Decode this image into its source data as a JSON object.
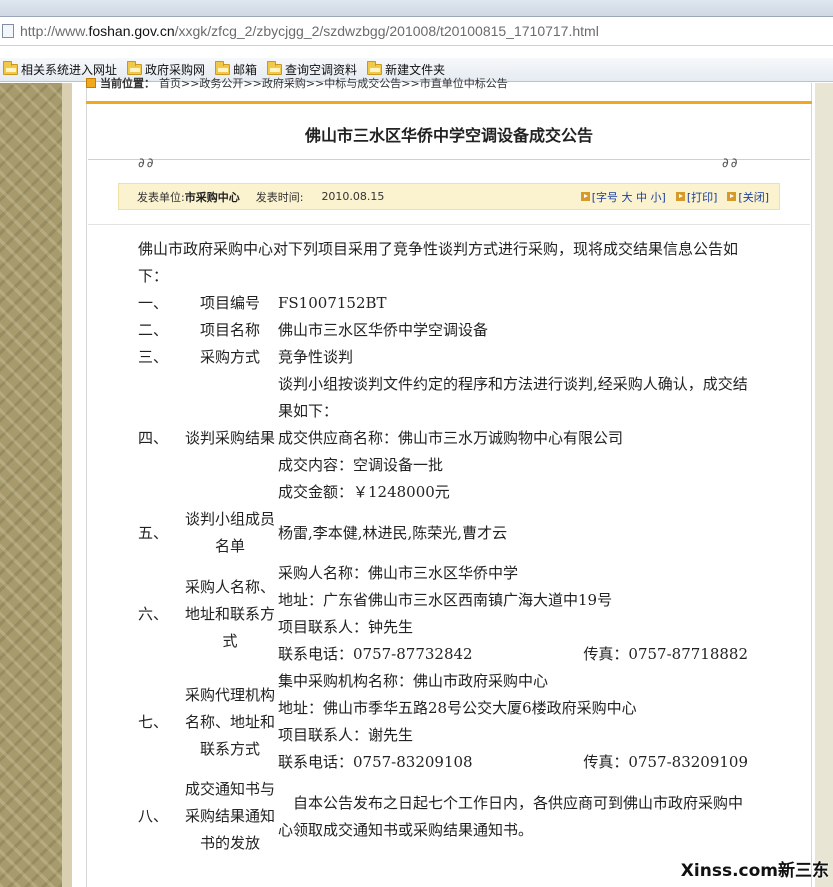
{
  "browser": {
    "url_gray_prefix": "http://www.",
    "url_domain": "foshan.gov.cn",
    "url_path": "/xxgk/zfcg_2/zbycjgg_2/szdwzbgg/201008/t20100815_1710717.html",
    "favorites": [
      "相关系统进入网址",
      "政府采购网",
      "邮箱",
      "查询空调资料",
      "新建文件夹"
    ]
  },
  "breadcrumb": {
    "label": "当前位置：",
    "path": "首页>>政务公开>>政府采购>>中标与成交公告>>市直单位中标公告"
  },
  "article": {
    "title": "佛山市三水区华侨中学空调设备成交公告",
    "rings_left": "∂∂",
    "rings_right": "∂∂",
    "publisher_label": "发表单位:",
    "publisher": "市采购中心",
    "time_label": "发表时间:",
    "date": "2010.08.15",
    "links": [
      "[字号 大 中 小]",
      "[打印]",
      "[关闭]"
    ],
    "intro": "佛山市政府采购中心对下列项目采用了竞争性谈判方式进行采购，现将成交结果信息公告如下：",
    "items": [
      {
        "num": "一、",
        "label": "项目编号",
        "lines": [
          "FS1007152BT"
        ]
      },
      {
        "num": "二、",
        "label": "项目名称",
        "lines": [
          "佛山市三水区华侨中学空调设备"
        ]
      },
      {
        "num": "三、",
        "label": "采购方式",
        "lines": [
          "竞争性谈判"
        ]
      },
      {
        "num": "四、",
        "label": "谈判采购结果",
        "lines": [
          "谈判小组按谈判文件约定的程序和方法进行谈判,经采购人确认，成交结果如下：",
          "成交供应商名称：佛山市三水万诚购物中心有限公司",
          "成交内容：空调设备一批",
          "成交金额：￥1248000元"
        ]
      },
      {
        "num": "五、",
        "label": "谈判小组成员名单",
        "lines": [
          "杨雷,李本健,林进民,陈荣光,曹才云"
        ]
      },
      {
        "num": "六、",
        "label": "采购人名称、地址和联系方式",
        "lines": [
          "采购人名称：佛山市三水区华侨中学",
          "地址：广东省佛山市三水区西南镇广海大道中19号",
          "项目联系人：钟先生"
        ],
        "phone": "联系电话：0757-87732842",
        "fax": "传真：0757-87718882"
      },
      {
        "num": "七、",
        "label": "采购代理机构名称、地址和联系方式",
        "lines": [
          "集中采购机构名称：佛山市政府采购中心",
          "地址：佛山市季华五路28号公交大厦6楼政府采购中心",
          "项目联系人：谢先生"
        ],
        "phone": "联系电话：0757-83209108",
        "fax": "传真：0757-83209109"
      },
      {
        "num": "八、",
        "label": "成交通知书与采购结果通知书的发放",
        "lines": [
          "　自本公告发布之日起七个工作日内，各供应商可到佛山市政府采购中心领取成交通知书或采购结果通知书。"
        ]
      }
    ]
  },
  "watermark": "Xinss.com新三东"
}
